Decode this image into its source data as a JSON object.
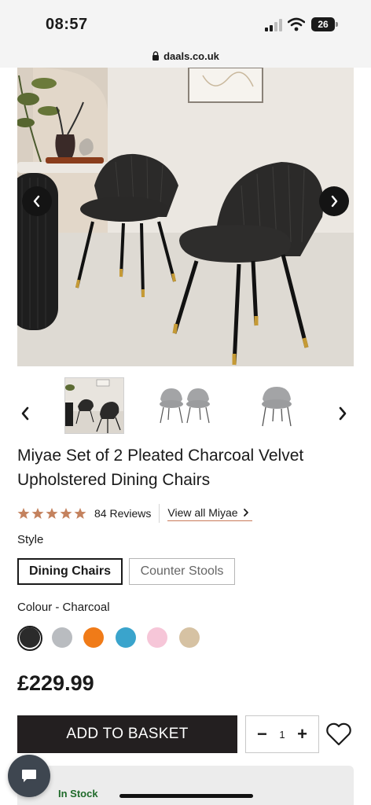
{
  "status_bar": {
    "time": "08:57",
    "battery": "26"
  },
  "browser": {
    "url": "daals.co.uk"
  },
  "gallery": {
    "prev_icon": "chevron-left-icon",
    "next_icon": "chevron-right-icon",
    "thumbnails": [
      "room-scene",
      "pair-front",
      "single-front"
    ]
  },
  "product": {
    "title": "Miyae Set of 2 Pleated Charcoal Velvet Upholstered Dining Chairs",
    "rating": 5,
    "reviews_label": "84 Reviews",
    "view_all_label": "View all Miyae",
    "style_label": "Style",
    "styles": [
      {
        "label": "Dining Chairs",
        "selected": true
      },
      {
        "label": "Counter Stools",
        "selected": false
      }
    ],
    "colour_label": "Colour - Charcoal",
    "colours": [
      {
        "name": "Charcoal",
        "hex": "#2b2b2b",
        "selected": true
      },
      {
        "name": "Grey",
        "hex": "#b9bcc0",
        "selected": false
      },
      {
        "name": "Orange",
        "hex": "#f07b18",
        "selected": false
      },
      {
        "name": "Teal",
        "hex": "#3aa4cc",
        "selected": false
      },
      {
        "name": "Pink",
        "hex": "#f6c6d8",
        "selected": false
      },
      {
        "name": "Beige",
        "hex": "#d6c2a3",
        "selected": false
      }
    ],
    "price": "£229.99"
  },
  "purchase": {
    "add_to_basket_label": "ADD TO BASKET",
    "quantity": "1",
    "decrement_label": "−",
    "increment_label": "+",
    "wishlist_icon": "heart-icon"
  },
  "stock": {
    "label": "In Stock"
  },
  "colors": {
    "star": "#c4825e",
    "stock_green": "#1f6a2a",
    "button_dark": "#231f20"
  }
}
